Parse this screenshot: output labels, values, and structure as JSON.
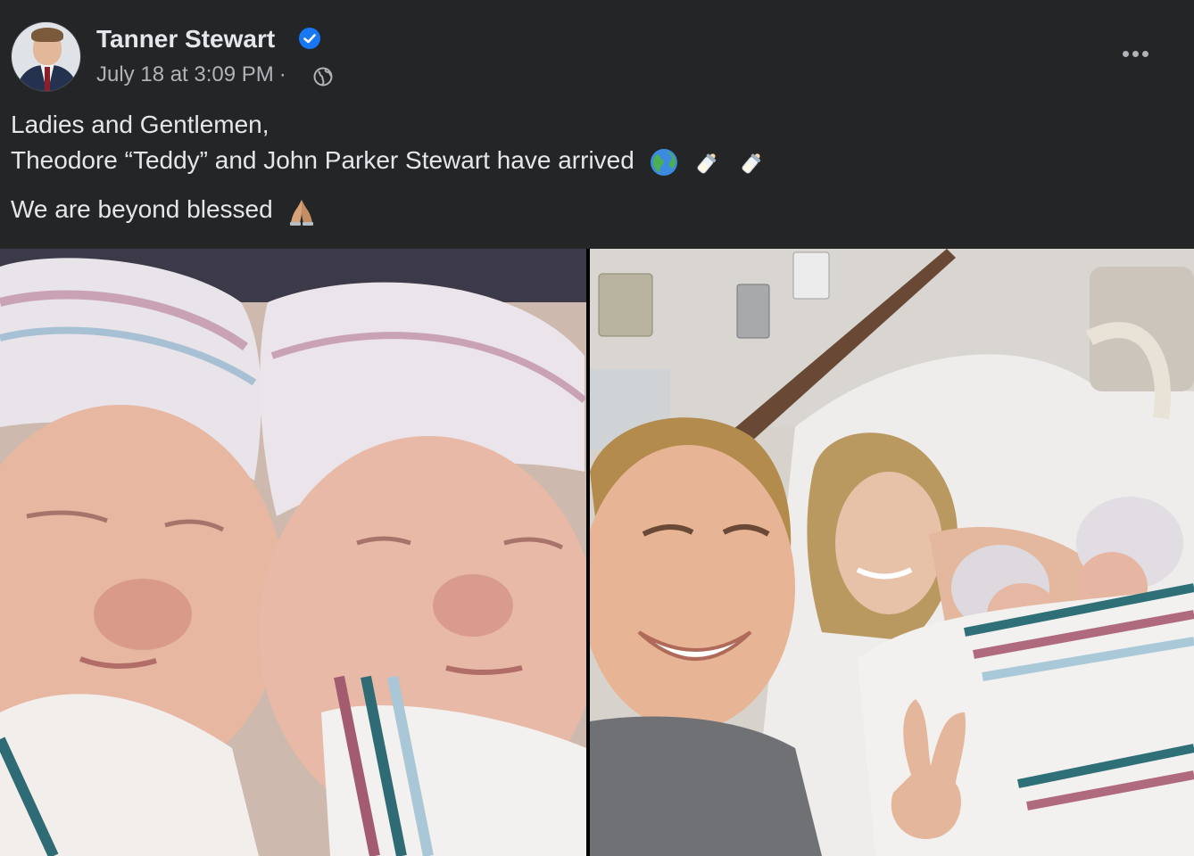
{
  "post": {
    "author": "Tanner Stewart",
    "timestamp": "July 18 at 3:09 PM",
    "separator": "·",
    "audience_icon": "globe-icon",
    "verified_icon": "verified-badge-icon",
    "more_icon": "more-options-icon",
    "lines": [
      "Ladies and Gentlemen,",
      "Theodore “Teddy” and John Parker Stewart have arrived",
      "We are beyond blessed"
    ],
    "line2_emojis": [
      "globe-emoji",
      "baby-bottle-emoji",
      "baby-bottle-emoji"
    ],
    "line3_emoji": "folded-hands-emoji"
  },
  "photos": {
    "left": "newborn-twins-photo",
    "right": "hospital-family-selfie-photo"
  },
  "colors": {
    "background": "#242526",
    "text_primary": "#e4e6eb",
    "text_secondary": "#b0b3b8",
    "verified_blue": "#1877f2"
  }
}
